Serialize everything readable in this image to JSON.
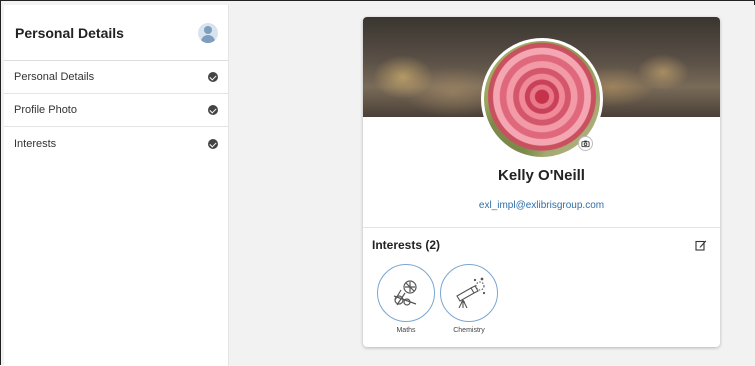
{
  "sidebar": {
    "title": "Personal Details",
    "items": [
      {
        "label": "Personal Details"
      },
      {
        "label": "Profile Photo"
      },
      {
        "label": "Interests"
      }
    ]
  },
  "profile": {
    "name": "Kelly O'Neill",
    "email": "exl_impl@exlibrisgroup.com"
  },
  "interests": {
    "title": "Interests (2)",
    "items": [
      {
        "label": "Maths",
        "icon": "maths-icon"
      },
      {
        "label": "Chemistry",
        "icon": "chemistry-icon"
      }
    ]
  },
  "colors": {
    "link": "#2f6fa8",
    "chip_border": "#7aa6d1"
  }
}
